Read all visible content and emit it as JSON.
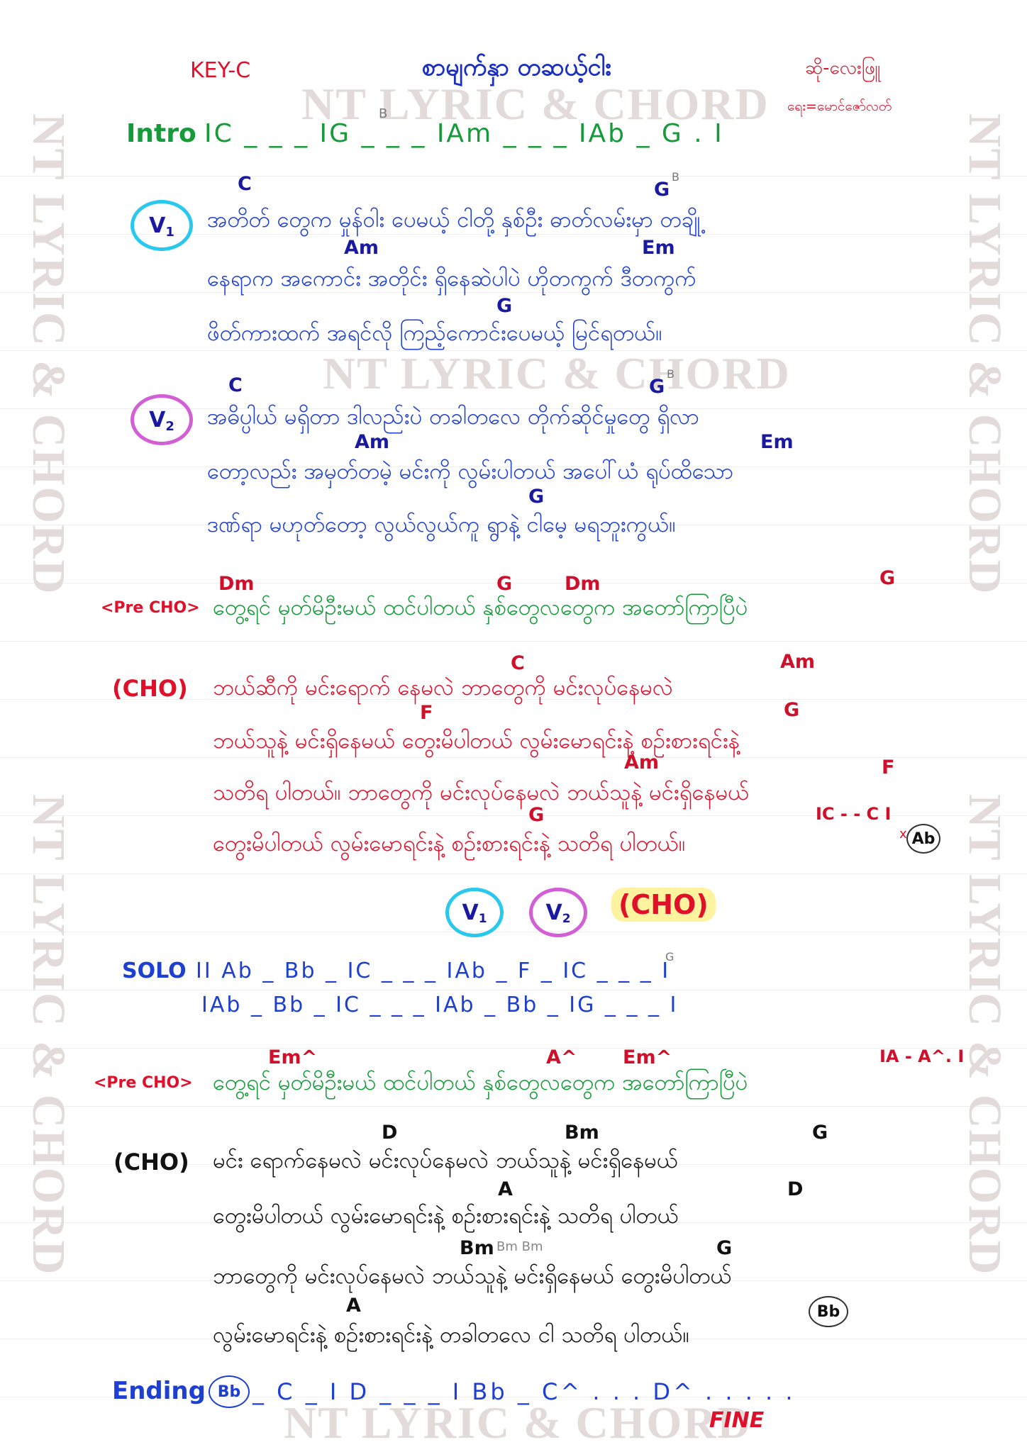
{
  "watermark": "NT LYRIC & CHORD",
  "header": {
    "key": "KEY-C",
    "title": "စာမျက်နှာ တဆယ့်ငါး",
    "singer": "ဆို-လေးဖြူ",
    "writer": "ရေး=မောင်ဇော်လတ်"
  },
  "intro": {
    "label": "Intro",
    "bars": "IC _ _ _ IG _ _ _ IAm _ _ _ IAb _ G . I",
    "slash": "B"
  },
  "verse1": {
    "badge": "V",
    "badge_sub": "1",
    "chords": {
      "c1": "C",
      "g1": "G",
      "gb": "B",
      "am": "Am",
      "em": "Em",
      "g2": "G"
    },
    "lines": [
      "အတိတ် တွေက မှုန်ဝါး ပေမယ့် ငါတို့ နှစ်ဦး ဓာတ်လမ်းမှာ တချို့",
      "နေရာက အကောင်း အတိုင်း ရှိနေဆဲပါပဲ ဟိုတကွက် ဒီတကွက်",
      "ဖိတ်ကားထက် အရင်လို ကြည့်ကောင်းပေမယ့် မြင်ရတယ်။"
    ]
  },
  "verse2": {
    "badge": "V",
    "badge_sub": "2",
    "chords": {
      "c1": "C",
      "g1": "G",
      "gb": "B",
      "am": "Am",
      "em": "Em",
      "g2": "G"
    },
    "lines": [
      "အဓိပ္ပါယ် မရှိတာ ဒါလည်းပဲ တခါတလေ တိုက်ဆိုင်မှုတွေ ရှိလာ",
      "တော့လည်း အမှတ်တမဲ့ မင်းကို လွမ်းပါတယ် အပေါ်ယံ ရုပ်ထိသော",
      "ဒဏ်ရာ မဟုတ်တော့ လွယ်လွယ်ကူ ရွာနဲ့ ငါမေ့ မရဘူးကွယ်။"
    ]
  },
  "prechorus1": {
    "label": "<Pre CHO>",
    "chords": [
      "Dm",
      "G",
      "Dm",
      "G"
    ],
    "text": "တွေ့ရင် မှတ်မိဦးမယ် ထင်ပါတယ် နှစ်တွေလတွေက အတော်ကြာပြီပဲ"
  },
  "chorus1": {
    "label": "(CHO)",
    "chords": [
      "C",
      "Am",
      "F",
      "G",
      "Am",
      "F",
      "G",
      "IC - - C I",
      "x"
    ],
    "circled": "Ab",
    "lines": [
      "ဘယ်ဆီကို မင်းရောက် နေမလဲ ဘာတွေကို မင်းလုပ်နေမလဲ",
      "ဘယ်သူနဲ့ မင်းရှိနေမယ် တွေးမိပါတယ် လွမ်းမောရင်းနဲ့ စဉ်းစားရင်းနဲ့",
      "သတိရ ပါတယ်။ ဘာတွေကို မင်းလုပ်နေမလဲ ဘယ်သူနဲ့ မင်းရှိနေမယ်",
      "တွေးမိပါတယ် လွမ်းမောရင်းနဲ့ စဉ်းစားရင်းနဲ့ သတိရ ပါတယ်။"
    ]
  },
  "repeat": {
    "v1": "V",
    "v1_sub": "1",
    "v2": "V",
    "v2_sub": "2",
    "cho": "(CHO)"
  },
  "solo": {
    "label": "SOLO",
    "line1": "II Ab _ Bb _ IC _ _ _ IAb _ F _ IC _ _ _ I",
    "line2": "IAb _ Bb _ IC _ _ _ IAb _ Bb _ IG _ _ _ I",
    "slash": "G"
  },
  "prechorus2": {
    "label": "<Pre CHO>",
    "chords": [
      "Em^",
      "A^",
      "Em^",
      "IA - A^. I"
    ],
    "text": "တွေ့ရင် မှတ်မိဦးမယ် ထင်ပါတယ် နှစ်တွေလတွေက အတော်ကြာပြီပဲ"
  },
  "chorus2": {
    "label": "(CHO)",
    "chords": [
      "D",
      "Bm",
      "G",
      "A",
      "D",
      "Bm",
      "Bm Bm",
      "G",
      "A"
    ],
    "circled": "Bb",
    "lines": [
      "မင်း ရောက်နေမလဲ မင်းလုပ်နေမလဲ ဘယ်သူနဲ့ မင်းရှိနေမယ်",
      "တွေးမိပါတယ် လွမ်းမောရင်းနဲ့ စဉ်းစားရင်းနဲ့ သတိရ ပါတယ်",
      "ဘာတွေကို မင်းလုပ်နေမလဲ ဘယ်သူနဲ့ မင်းရှိနေမယ် တွေးမိပါတယ်",
      "လွမ်းမောရင်းနဲ့ စဉ်းစားရင်းနဲ့ တခါတလေ ငါ သတိရ ပါတယ်။"
    ]
  },
  "ending": {
    "label": "Ending",
    "circled": "Bb",
    "bars": "_ C _ I D _ _ _ I Bb _ C^ . . . D^ . . . . .",
    "fine": "FINE"
  }
}
